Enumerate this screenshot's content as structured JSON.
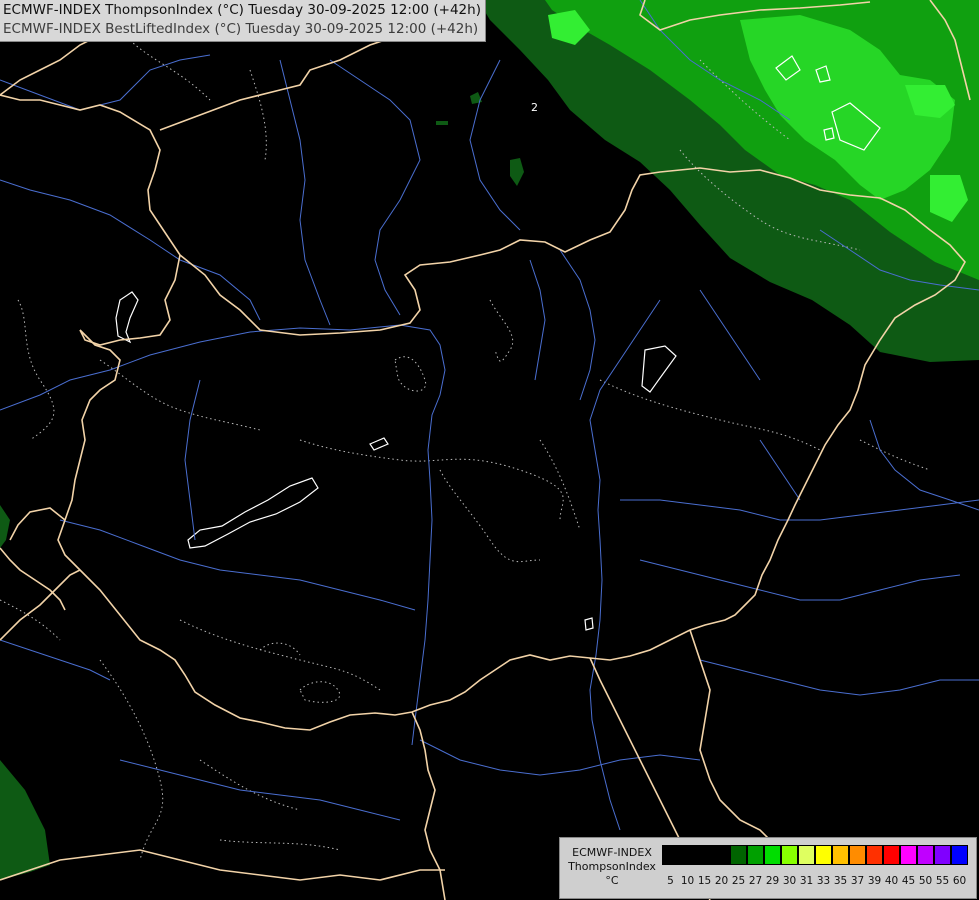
{
  "title": {
    "line1": "ECMWF-INDEX ThompsonIndex (°C) Tuesday 30-09-2025 12:00 (+42h)",
    "line2": "ECMWF-INDEX BestLiftedIndex (°C) Tuesday 30-09-2025 12:00 (+42h)"
  },
  "contour_label": "2",
  "legend": {
    "title1": "ECMWF-INDEX",
    "title2": "ThompsonIndex",
    "unit": "°C",
    "ticks": [
      "5",
      "10",
      "15",
      "20",
      "25",
      "27",
      "29",
      "30",
      "31",
      "33",
      "35",
      "37",
      "39",
      "40",
      "45",
      "50",
      "55",
      "60"
    ],
    "colors": [
      "#000000",
      "#000000",
      "#000000",
      "#000000",
      "#006400",
      "#00a000",
      "#00dd00",
      "#88ff00",
      "#dfff60",
      "#ffff00",
      "#ffc000",
      "#ff8c00",
      "#ff3000",
      "#ff0000",
      "#ff00ff",
      "#c000ff",
      "#8000ff",
      "#0000ff"
    ]
  },
  "colors": {
    "background": "#000000",
    "border": "#f2d3a8",
    "river": "#4a6ed0",
    "dark_green": "#0e5a14",
    "mid_green": "#10a010",
    "bright_green": "#22dd22",
    "contour": "#ffffff"
  }
}
